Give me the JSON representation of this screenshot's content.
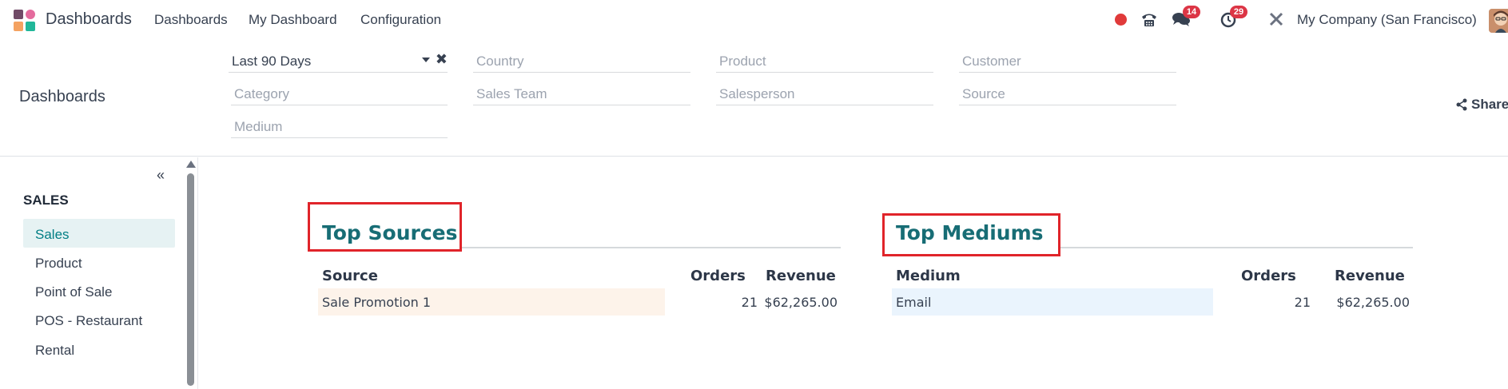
{
  "topnav": {
    "app_name": "Dashboards",
    "menu": [
      "Dashboards",
      "My Dashboard",
      "Configuration"
    ],
    "messages_count": "14",
    "activities_count": "29",
    "company": "My Company (San Francisco)"
  },
  "control": {
    "breadcrumb": "Dashboards",
    "share_label": "Share",
    "filters": {
      "period": "Last 90 Days",
      "country": "Country",
      "product": "Product",
      "customer": "Customer",
      "category": "Category",
      "sales_team": "Sales Team",
      "salesperson": "Salesperson",
      "source": "Source",
      "medium": "Medium"
    }
  },
  "sidebar": {
    "section": "SALES",
    "items": [
      "Sales",
      "Product",
      "Point of Sale",
      "POS - Restaurant",
      "Rental"
    ],
    "active_index": 0
  },
  "top_sources": {
    "title": "Top Sources",
    "headers": [
      "Source",
      "Orders",
      "Revenue"
    ],
    "rows": [
      {
        "name": "Sale Promotion 1",
        "orders": "21",
        "revenue": "$62,265.00"
      }
    ]
  },
  "top_mediums": {
    "title": "Top Mediums",
    "headers": [
      "Medium",
      "Orders",
      "Revenue"
    ],
    "rows": [
      {
        "name": "Email",
        "orders": "21",
        "revenue": "$62,265.00"
      }
    ]
  },
  "colors": {
    "accent": "#017e84",
    "title": "#176d75",
    "highlight_box": "#e0242a",
    "badge": "#dc3545",
    "source_row_bg": "#fdf3ea",
    "medium_row_bg": "#eaf4fd"
  }
}
